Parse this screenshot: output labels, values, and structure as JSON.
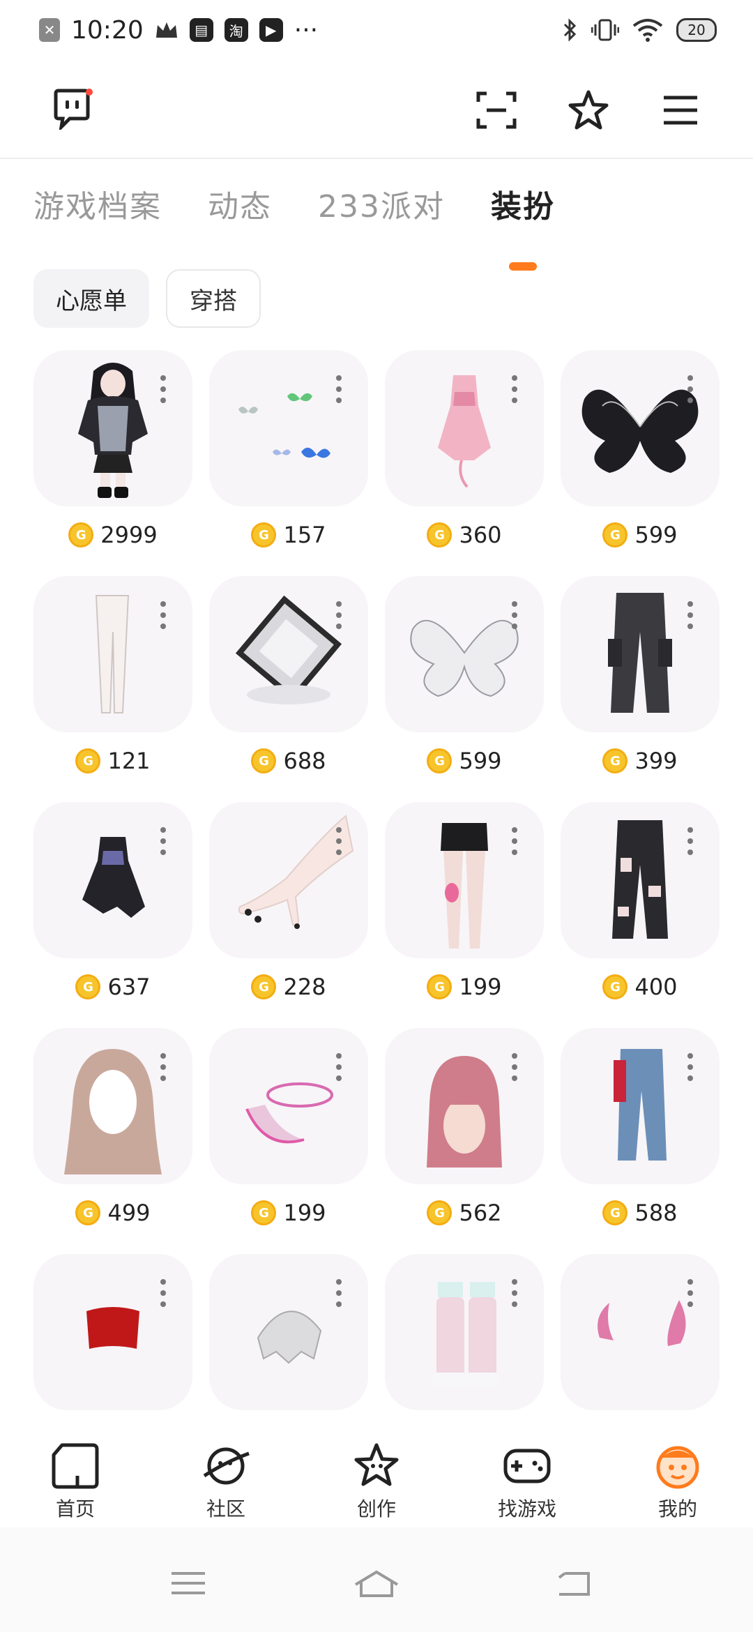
{
  "status_bar": {
    "time": "10:20",
    "app_icons": [
      "crown-icon",
      "book-icon",
      "淘",
      "play-icon"
    ],
    "more": "···",
    "battery": "20"
  },
  "tabs": [
    {
      "label": "游戏档案",
      "active": false
    },
    {
      "label": "动态",
      "active": false
    },
    {
      "label": "233派对",
      "active": false
    },
    {
      "label": "装扮",
      "active": true
    }
  ],
  "subtabs": [
    {
      "label": "心愿单",
      "active": true
    },
    {
      "label": "穿搭",
      "active": false
    }
  ],
  "coin_glyph": "G",
  "items": [
    {
      "price": "2999",
      "name": "black-outfit"
    },
    {
      "price": "157",
      "name": "butterflies"
    },
    {
      "price": "360",
      "name": "pink-dress"
    },
    {
      "price": "599",
      "name": "black-flower-wings"
    },
    {
      "price": "121",
      "name": "white-tights"
    },
    {
      "price": "688",
      "name": "crystal-frame"
    },
    {
      "price": "599",
      "name": "white-flower-wings"
    },
    {
      "price": "399",
      "name": "black-cargo-pants"
    },
    {
      "price": "637",
      "name": "black-lolita-skirt"
    },
    {
      "price": "228",
      "name": "hand-nails"
    },
    {
      "price": "199",
      "name": "black-shorts-legs"
    },
    {
      "price": "400",
      "name": "ripped-jeans"
    },
    {
      "price": "499",
      "name": "brown-hair"
    },
    {
      "price": "199",
      "name": "glow-ring"
    },
    {
      "price": "562",
      "name": "pink-hair"
    },
    {
      "price": "588",
      "name": "blue-jeans"
    },
    {
      "price": "",
      "name": "red-top"
    },
    {
      "price": "",
      "name": "lace-scarf"
    },
    {
      "price": "",
      "name": "pink-boots"
    },
    {
      "price": "",
      "name": "pink-horns"
    }
  ],
  "bottom_nav": [
    {
      "label": "首页",
      "active": false
    },
    {
      "label": "社区",
      "active": false
    },
    {
      "label": "创作",
      "active": false
    },
    {
      "label": "找游戏",
      "active": false
    },
    {
      "label": "我的",
      "active": true
    }
  ],
  "colors": {
    "accent": "#ff7b1c",
    "coin": "#f7c42c"
  }
}
